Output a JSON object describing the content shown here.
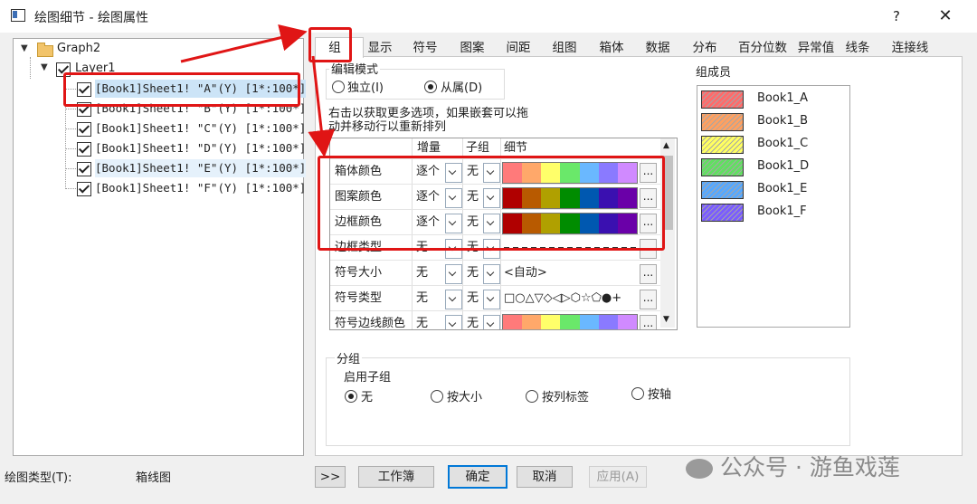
{
  "window": {
    "title": "绘图细节 - 绘图属性",
    "help": "?",
    "close": "✕"
  },
  "tree": {
    "root": "Graph2",
    "layer": "Layer1",
    "items": [
      "[Book1]Sheet1! \"A\"(Y) [1*:100*]",
      "[Book1]Sheet1! \"B\"(Y) [1*:100*]",
      "[Book1]Sheet1! \"C\"(Y) [1*:100*]",
      "[Book1]Sheet1! \"D\"(Y) [1*:100*]",
      "[Book1]Sheet1! \"E\"(Y) [1*:100*]",
      "[Book1]Sheet1! \"F\"(Y) [1*:100*]"
    ]
  },
  "footer": {
    "plot_type_label": "绘图类型(T):",
    "plot_type_value": "箱线图"
  },
  "tabs": [
    "组",
    "显示",
    "符号",
    "图案",
    "间距",
    "组图",
    "箱体",
    "数据",
    "分布",
    "百分位数",
    "异常值",
    "线条",
    "连接线"
  ],
  "edit_mode": {
    "title": "编辑模式",
    "independent": "独立(I)",
    "dependent": "从属(D)",
    "selected": "dependent"
  },
  "hint": [
    "右击以获取更多选项，如果嵌套可以拖",
    "动并移动行以重新排列"
  ],
  "grid": {
    "headers": [
      "增量",
      "子组",
      "细节"
    ],
    "rows": [
      {
        "name": "箱体颜色",
        "inc": "逐个",
        "sub": "无",
        "detail_kind": "light"
      },
      {
        "name": "图案颜色",
        "inc": "逐个",
        "sub": "无",
        "detail_kind": "dark"
      },
      {
        "name": "边框颜色",
        "inc": "逐个",
        "sub": "无",
        "detail_kind": "dark"
      },
      {
        "name": "边框类型",
        "inc": "无",
        "sub": "无",
        "detail_kind": "lines"
      },
      {
        "name": "符号大小",
        "inc": "无",
        "sub": "无",
        "detail_text": "<自动>"
      },
      {
        "name": "符号类型",
        "inc": "无",
        "sub": "无",
        "detail_text": "□○△▽◇◁▷⬡☆⬠●+"
      },
      {
        "name": "符号边线颜色",
        "inc": "无",
        "sub": "无",
        "detail_kind": "light"
      }
    ],
    "light_colors": [
      "#ff7a7a",
      "#ffa86a",
      "#ffff6a",
      "#6ae86a",
      "#6ab8ff",
      "#8a7aff",
      "#d08aff"
    ],
    "dark_colors": [
      "#b00000",
      "#b85a00",
      "#b0a000",
      "#008c00",
      "#0058b0",
      "#3a10b0",
      "#6a00a8"
    ]
  },
  "members": {
    "title": "组成员",
    "items": [
      {
        "label": "Book1_A",
        "color": "#ff6b6b"
      },
      {
        "label": "Book1_B",
        "color": "#ffa060"
      },
      {
        "label": "Book1_C",
        "color": "#ffff60"
      },
      {
        "label": "Book1_D",
        "color": "#60e060"
      },
      {
        "label": "Book1_E",
        "color": "#55a8ff"
      },
      {
        "label": "Book1_F",
        "color": "#7a5cff"
      }
    ]
  },
  "subgroup": {
    "title": "分组",
    "enable": "启用子组",
    "options": [
      "无",
      "按大小",
      "按列标签",
      "按轴"
    ],
    "selected": 0
  },
  "buttons": {
    "expand": ">>",
    "workbook": "工作簿",
    "ok": "确定",
    "cancel": "取消",
    "apply": "应用(A)"
  },
  "watermark": "公众号 · 游鱼戏莲"
}
